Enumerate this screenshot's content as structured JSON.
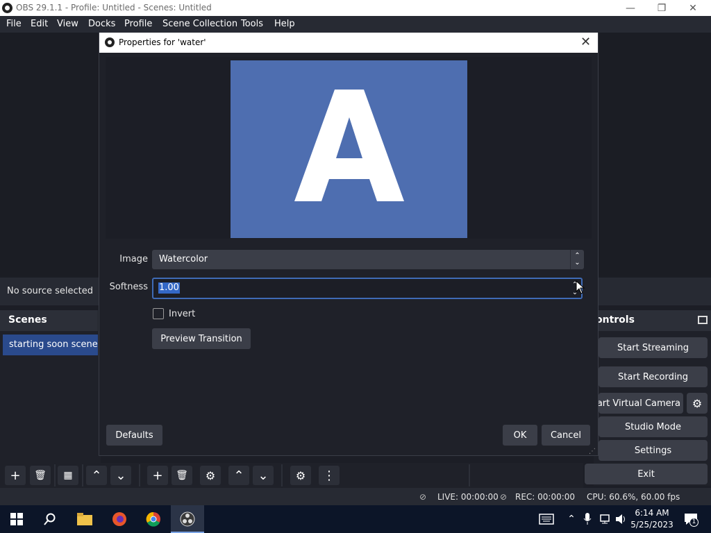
{
  "window": {
    "title": "OBS 29.1.1 - Profile: Untitled - Scenes: Untitled",
    "minimize_glyph": "—",
    "maximize_glyph": "❐",
    "close_glyph": "✕"
  },
  "menu": [
    "File",
    "Edit",
    "View",
    "Docks",
    "Profile",
    "Scene Collection",
    "Tools",
    "Help"
  ],
  "source_bar": {
    "text": "No source selected"
  },
  "scenes": {
    "header": "Scenes",
    "items": [
      "starting soon scene"
    ]
  },
  "controls": {
    "header": "ontrols",
    "buttons": {
      "start_streaming": "Start Streaming",
      "start_recording": "Start Recording",
      "start_virtual_camera": "art Virtual Camera",
      "studio_mode": "Studio Mode",
      "settings": "Settings",
      "exit": "Exit"
    }
  },
  "toolbar": {
    "add_glyph": "+",
    "remove_glyph": "🗑",
    "filter_glyph": "▦",
    "up_glyph": "⌃",
    "down_glyph": "⌄",
    "gear_glyph": "⚙",
    "more_glyph": "⋮"
  },
  "status": {
    "live": "LIVE: 00:00:00",
    "rec": "REC: 00:00:00",
    "cpu": "CPU: 60.6%, 60.00 fps"
  },
  "taskbar": {
    "time": "6:14 AM",
    "date": "5/25/2023",
    "notification_count": "1"
  },
  "dialog": {
    "title": "Properties for 'water'",
    "close_glyph": "✕",
    "preview_letter": "A",
    "image_label": "Image",
    "image_value": "Watercolor",
    "softness_label": "Softness",
    "softness_value": "1.00",
    "invert_label": "Invert",
    "invert_checked": false,
    "preview_transition_label": "Preview Transition",
    "defaults_label": "Defaults",
    "ok_label": "OK",
    "cancel_label": "Cancel"
  },
  "colors": {
    "accent": "#2a4a8c",
    "preview_blue": "#4e6eb0",
    "focus_border": "#3f6bb6",
    "background": "#1c1e26"
  }
}
